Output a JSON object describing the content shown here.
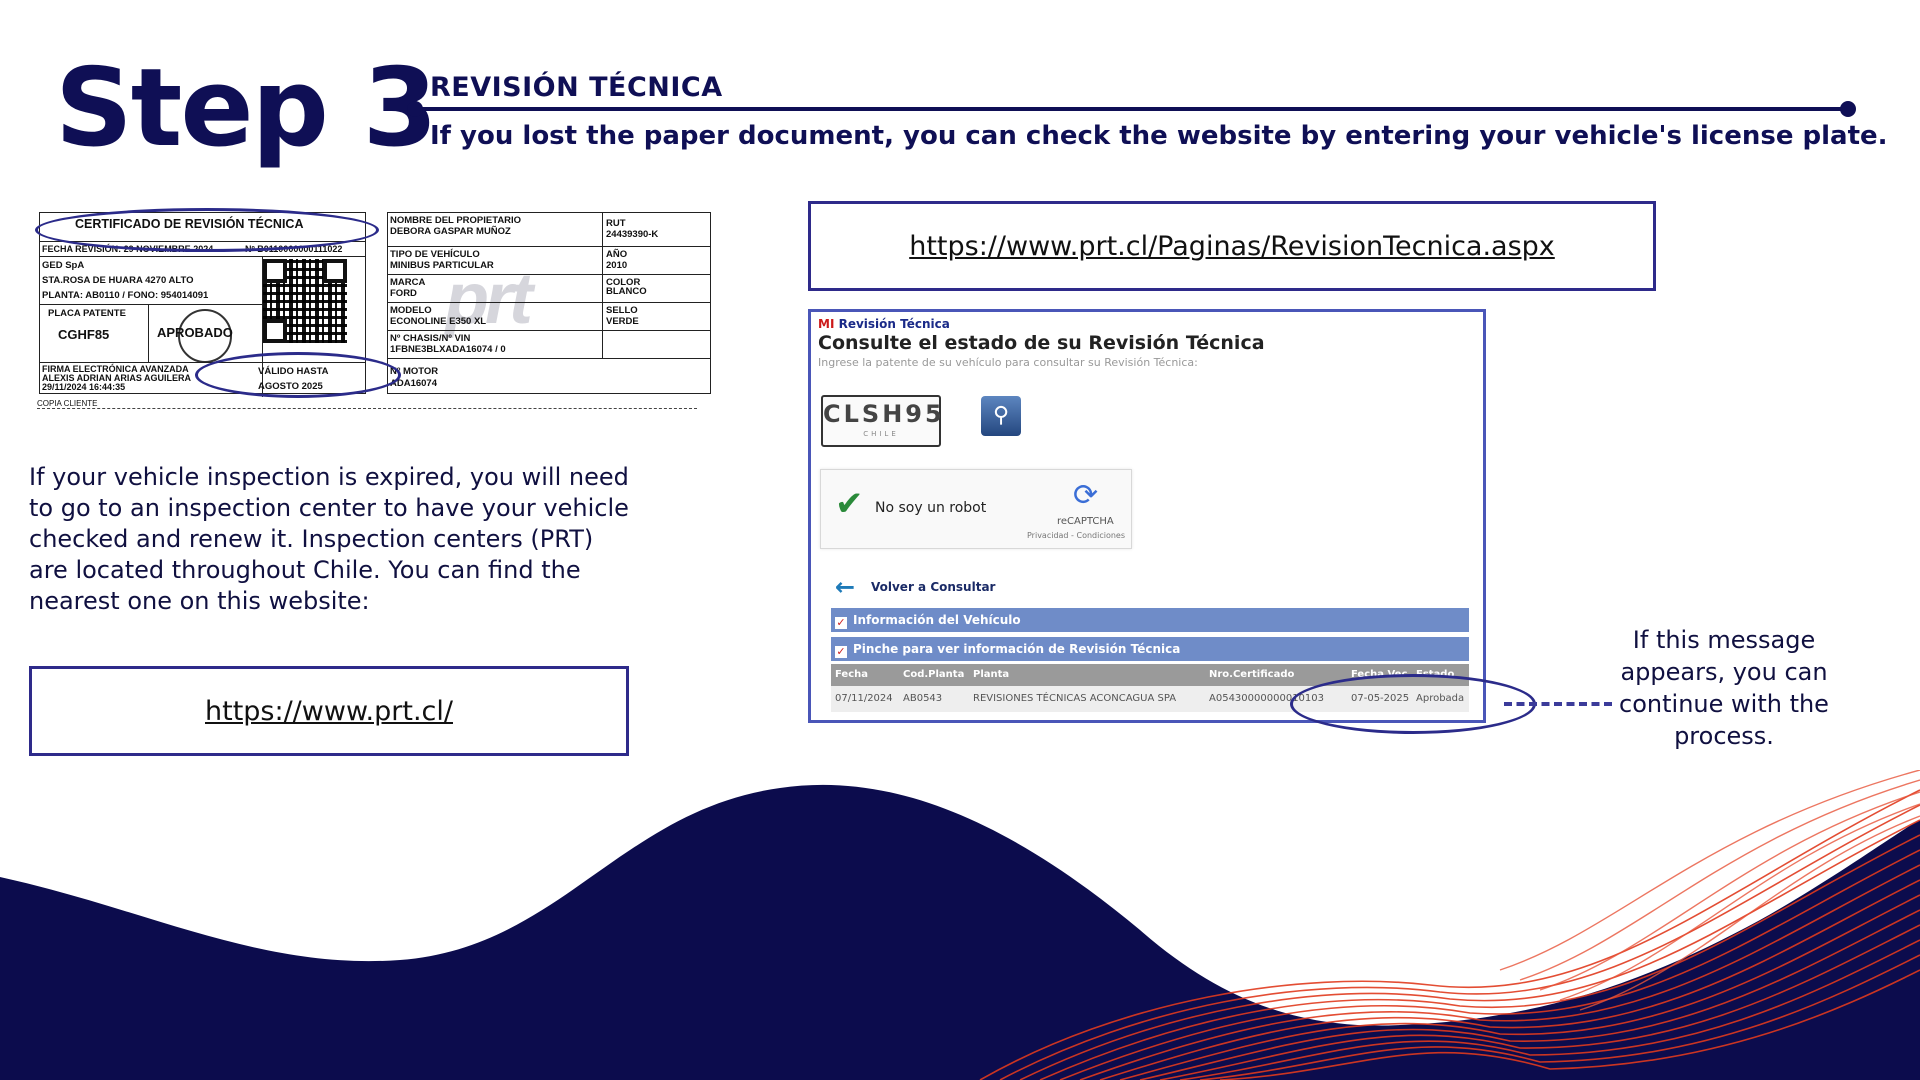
{
  "header": {
    "step": "Step 3",
    "section": "REVISIÓN TÉCNICA",
    "subtitle": "If you lost the paper document, you can check the website by entering your vehicle's license plate."
  },
  "certificate": {
    "title": "CERTIFICADO DE REVISIÓN TÉCNICA",
    "fecha": "FECHA REVISIÓN: 29 NOVIEMBRE 2024",
    "numero": "Nº B0110000000111022",
    "company": "GED SpA",
    "address": "STA.ROSA DE HUARA 4270 ALTO",
    "planta": "PLANTA: AB0110 / FONO: 954014091",
    "placa_label": "PLACA PATENTE",
    "placa_value": "CGHF85",
    "result": "APROBADO",
    "firma_1": "FIRMA ELECTRÓNICA AVANZADA",
    "firma_2": "ALEXIS ADRIAN ARIAS AGUILERA",
    "firma_3": "29/11/2024 16:44:35",
    "valido_label": "VÁLIDO HASTA",
    "valido_value": "AGOSTO 2025",
    "copia": "COPIA CLIENTE",
    "owner_label": "NOMBRE DEL PROPIETARIO",
    "owner_value": "DEBORA GASPAR MUÑOZ",
    "rut_label": "RUT",
    "rut_value": "24439390-K",
    "tipo_label": "TIPO DE VEHÍCULO",
    "tipo_value": "MINIBUS PARTICULAR",
    "anio_label": "AÑO",
    "anio_value": "2010",
    "marca_label": "MARCA",
    "marca_value": "FORD",
    "color_label": "COLOR",
    "color_value": "BLANCO",
    "modelo_label": "MODELO",
    "modelo_value": "ECONOLINE E350 XL",
    "sello_label": "SELLO",
    "sello_value": "VERDE",
    "chasis_label": "Nº CHASIS/Nº VIN",
    "chasis_value": "1FBNE3BLXADA16074  /  0",
    "motor_label": "Nº MOTOR",
    "motor_value": "ADA16074",
    "watermark": "prt"
  },
  "body_text": "If your vehicle inspection is expired, you will need to go to an inspection center to have your vehicle checked and renew it. Inspection centers (PRT) are located throughout Chile. You can find the nearest one on this website:",
  "links": {
    "home": "https://www.prt.cl/",
    "revision": "https://www.prt.cl/Paginas/RevisionTecnica.aspx"
  },
  "panel": {
    "brand_prefix": "MI",
    "brand": "Revisión Técnica",
    "heading": "Consulte el estado de su Revisión Técnica",
    "hint": "Ingrese la patente de su vehículo para consultar su Revisión Técnica:",
    "plate": "CLSH95",
    "plate_country": "CHILE",
    "captcha_label": "No soy un robot",
    "captcha_brand": "reCAPTCHA",
    "captcha_terms": "Privacidad - Condiciones",
    "back_label": "Volver a Consultar",
    "bar_vehicle": "Información del Vehículo",
    "bar_revision": "Pinche para ver información de Revisión Técnica",
    "columns": [
      "Fecha",
      "Cod.Planta",
      "Planta",
      "Nro.Certificado",
      "Fecha Vec.",
      "Estado"
    ],
    "row": [
      "07/11/2024",
      "AB0543",
      "REVISIONES TÉCNICAS ACONCAGUA SPA",
      "A05430000000010103",
      "07-05-2025",
      "Aprobada"
    ]
  },
  "note": "If this message appears, you can continue with the process.",
  "colors": {
    "navy": "#0f0f55",
    "accent_blue": "#2e2a8a",
    "wave_red": "#e03a1e"
  }
}
